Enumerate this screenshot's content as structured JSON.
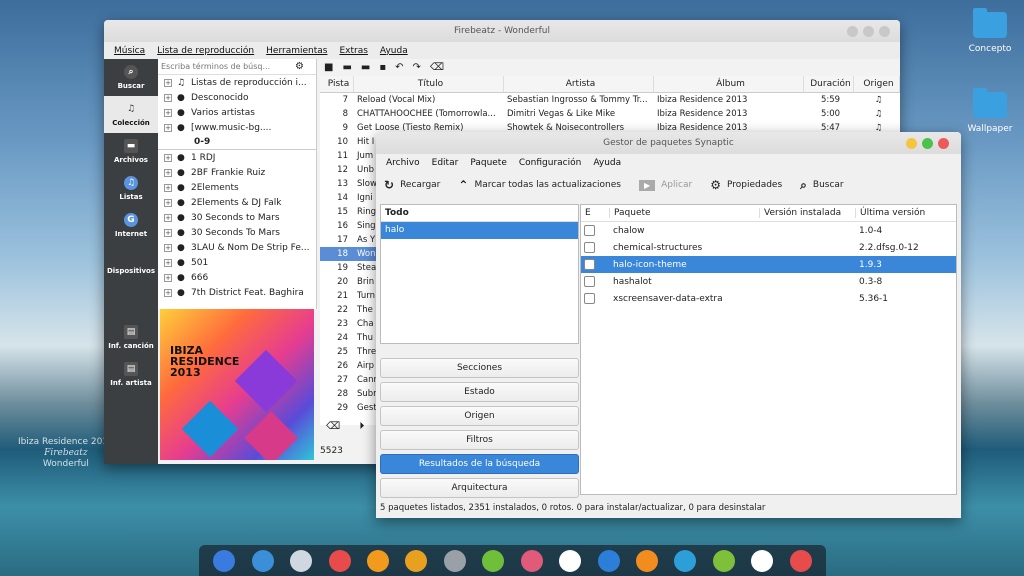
{
  "desktop": {
    "icons": [
      "Concepto",
      "Wallpaper"
    ],
    "watermark": [
      "Ibiza Residence 2013",
      "Firebeatz",
      "Wonderful"
    ]
  },
  "firebeatz": {
    "title": "Firebeatz - Wonderful",
    "menu": [
      "Música",
      "Lista de reproducción",
      "Herramientas",
      "Extras",
      "Ayuda"
    ],
    "sidebar": [
      "Buscar",
      "Colección",
      "Archivos",
      "Listas",
      "Internet",
      "Dispositivos",
      "Inf. canción",
      "Inf. artista"
    ],
    "search_placeholder": "Escriba términos de búsq...",
    "tree": [
      "Listas de reproducción i...",
      "Desconocido",
      "Varios artistas",
      "[www.music-bg....",
      "0-9",
      "1 RDJ",
      "2BF Frankie Ruiz",
      "2Elements",
      "2Elements & DJ Falk",
      "30 Seconds to Mars",
      "30 Seconds To Mars",
      "3LAU & Nom De Strip Fe...",
      "501",
      "666",
      "7th District Feat. Baghira"
    ],
    "art_text": "IBIZA RESIDENCE 2013",
    "columns": [
      "Pista",
      "Título",
      "Artista",
      "Álbum",
      "Duración",
      "Origen"
    ],
    "rows": [
      [
        "7",
        "Reload (Vocal Mix)",
        "Sebastian Ingrosso & Tommy Tr...",
        "Ibiza Residence 2013",
        "5:59",
        "♫"
      ],
      [
        "8",
        "CHATTAHOOCHEE (Tomorrowla...",
        "Dimitri Vegas & Like Mike",
        "Ibiza Residence 2013",
        "5:00",
        "♫"
      ],
      [
        "9",
        "Get Loose (Tiesto Remix)",
        "Showtek & Noisecontrollers",
        "Ibiza Residence 2013",
        "5:47",
        "♫"
      ],
      [
        "10",
        "Hit I",
        "",
        "",
        "",
        ""
      ],
      [
        "11",
        "Jum",
        "",
        "",
        "",
        ""
      ],
      [
        "12",
        "Unb",
        "",
        "",
        "",
        ""
      ],
      [
        "13",
        "Slow",
        "",
        "",
        "",
        ""
      ],
      [
        "14",
        "Igni",
        "",
        "",
        "",
        ""
      ],
      [
        "15",
        "Ring",
        "",
        "",
        "",
        ""
      ],
      [
        "16",
        "Sing",
        "",
        "",
        "",
        ""
      ],
      [
        "17",
        "As Y",
        "",
        "",
        "",
        ""
      ],
      [
        "18",
        "Won",
        "",
        "",
        "",
        ""
      ],
      [
        "19",
        "Stea",
        "",
        "",
        "",
        ""
      ],
      [
        "20",
        "Brin",
        "",
        "",
        "",
        ""
      ],
      [
        "21",
        "Turn",
        "",
        "",
        "",
        ""
      ],
      [
        "22",
        "The",
        "",
        "",
        "",
        ""
      ],
      [
        "23",
        "Cha",
        "",
        "",
        "",
        ""
      ],
      [
        "24",
        "Thu",
        "",
        "",
        "",
        ""
      ],
      [
        "25",
        "Thre",
        "",
        "",
        "",
        ""
      ],
      [
        "26",
        "Airp",
        "",
        "",
        "",
        ""
      ],
      [
        "27",
        "Canr",
        "",
        "",
        "",
        ""
      ],
      [
        "28",
        "Subr",
        "",
        "",
        "",
        ""
      ],
      [
        "29",
        "Gest",
        "",
        "",
        "",
        ""
      ]
    ],
    "status": "5523"
  },
  "synaptic": {
    "title": "Gestor de paquetes Synaptic",
    "menu": [
      "Archivo",
      "Editar",
      "Paquete",
      "Configuración",
      "Ayuda"
    ],
    "toolbar": [
      "Recargar",
      "Marcar todas las actualizaciones",
      "Aplicar",
      "Propiedades",
      "Buscar"
    ],
    "left_header": "Todo",
    "left_items": [
      "halo"
    ],
    "filters": [
      "Secciones",
      "Estado",
      "Origen",
      "Filtros",
      "Resultados de la búsqueda",
      "Arquitectura"
    ],
    "columns": [
      "E",
      "Paquete",
      "Versión instalada",
      "Última versión"
    ],
    "packages": [
      [
        "chalow",
        "",
        "1.0-4"
      ],
      [
        "chemical-structures",
        "",
        "2.2.dfsg.0-12"
      ],
      [
        "halo-icon-theme",
        "",
        "1.9.3"
      ],
      [
        "hashalot",
        "",
        "0.3-8"
      ],
      [
        "xscreensaver-data-extra",
        "",
        "5.36-1"
      ]
    ],
    "status": "5 paquetes listados, 2351 instalados, 0 rotos. 0 para instalar/actualizar, 0 para desinstalar"
  },
  "dock": [
    "rocket",
    "windows",
    "finder",
    "pencil",
    "orange",
    "chrome",
    "settings",
    "spotify",
    "mail",
    "vlc",
    "steam",
    "firefox",
    "wifi",
    "android",
    "clock",
    "trash"
  ],
  "colors": {
    "accent": "#3a86d8",
    "sidebar": "#3c3f41"
  }
}
